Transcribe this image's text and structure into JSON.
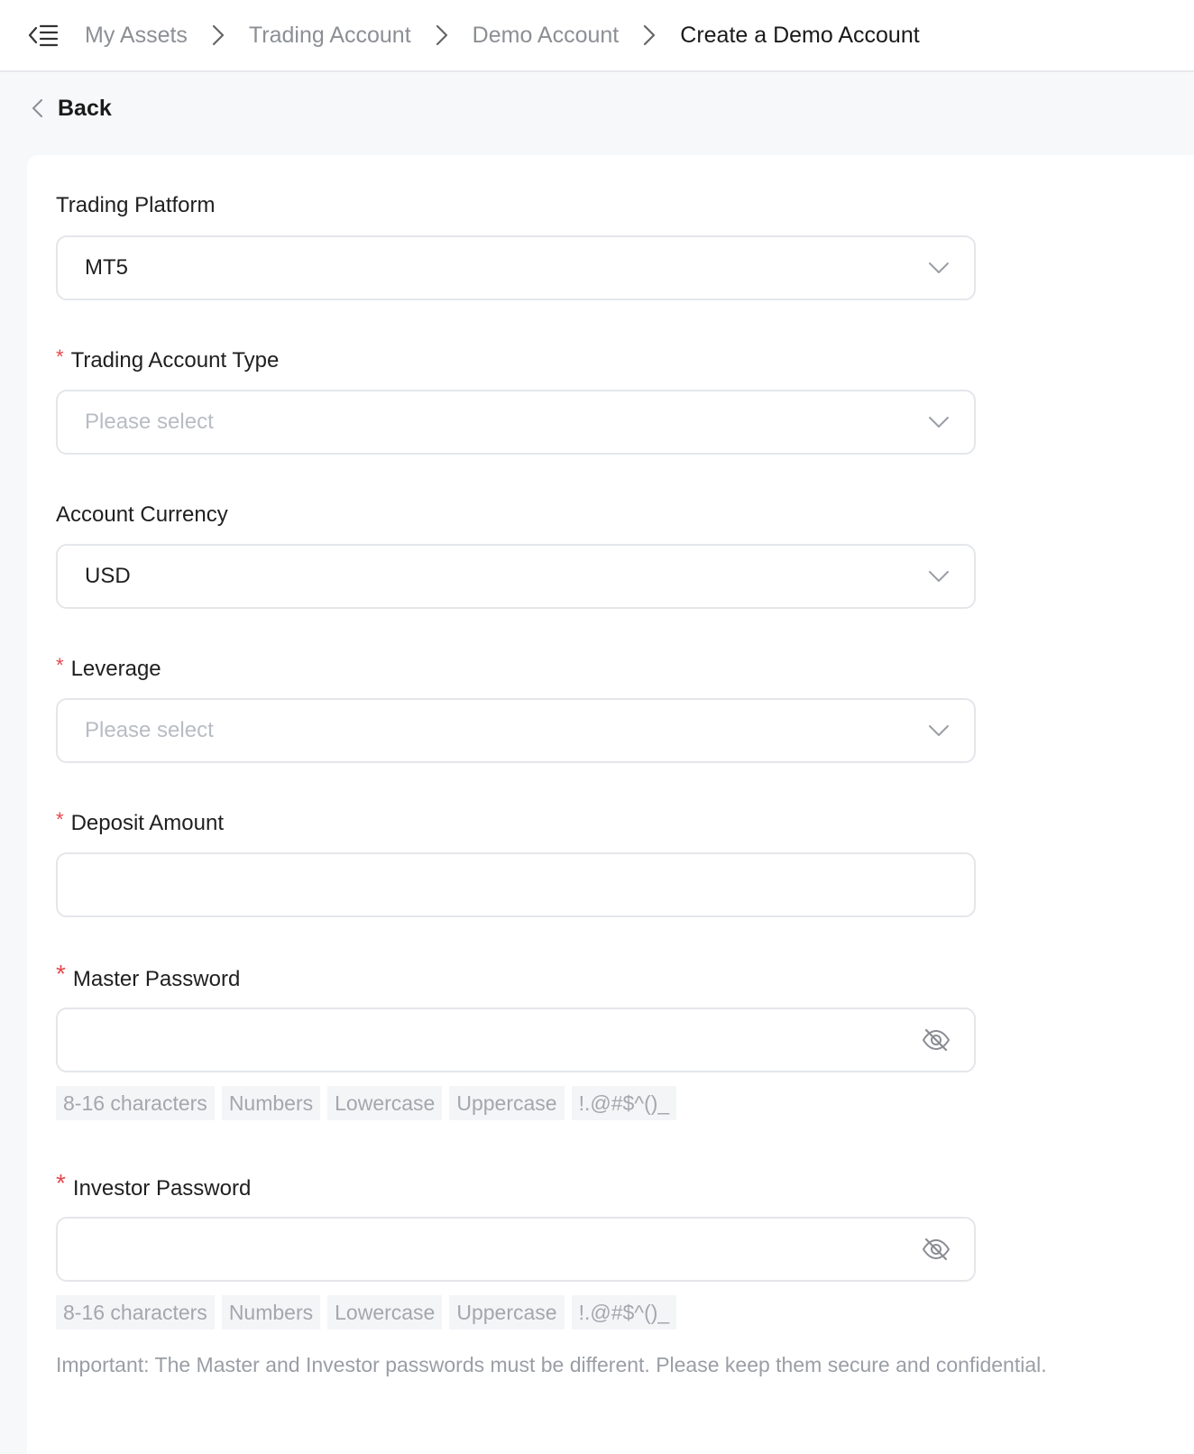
{
  "breadcrumb": {
    "items": [
      "My Assets",
      "Trading Account",
      "Demo Account"
    ],
    "current": "Create a Demo Account"
  },
  "back": {
    "label": "Back"
  },
  "form": {
    "trading_platform": {
      "label": "Trading Platform",
      "value": "MT5",
      "required": false
    },
    "account_type": {
      "label": "Trading Account Type",
      "placeholder": "Please select",
      "required": true
    },
    "account_currency": {
      "label": "Account Currency",
      "value": "USD",
      "required": false
    },
    "leverage": {
      "label": "Leverage",
      "placeholder": "Please select",
      "required": true
    },
    "deposit_amount": {
      "label": "Deposit Amount",
      "value": "",
      "required": true
    },
    "master_password": {
      "label": "Master Password",
      "value": "",
      "required": true,
      "hints": [
        "8-16 characters",
        "Numbers",
        "Lowercase",
        "Uppercase",
        "!.@#$^()_"
      ]
    },
    "investor_password": {
      "label": "Investor Password",
      "value": "",
      "required": true,
      "hints": [
        "8-16 characters",
        "Numbers",
        "Lowercase",
        "Uppercase",
        "!.@#$^()_"
      ]
    },
    "required_marker": "*",
    "note": "Important: The Master and Investor passwords must be different. Please keep them secure and confidential."
  },
  "icons": {
    "menu": "menu-collapse-icon",
    "breadcrumb_separator": "chevron-right-icon",
    "back": "chevron-left-icon",
    "select": "chevron-down-icon",
    "password_toggle": "eye-off-icon"
  },
  "colors": {
    "required": "#e5484d",
    "muted_text": "#8c8f94",
    "border": "#e4e6ea",
    "page_bg": "#f7f8fa"
  }
}
